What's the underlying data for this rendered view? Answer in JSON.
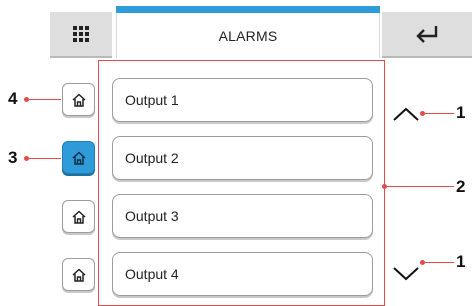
{
  "header": {
    "menu_icon": "grid-menu-icon",
    "title": "ALARMS",
    "back_icon": "enter-return-icon",
    "accent_color": "#2f9bd8"
  },
  "outputs": [
    {
      "label": "Output 1",
      "home_active": false
    },
    {
      "label": "Output 2",
      "home_active": true
    },
    {
      "label": "Output 3",
      "home_active": false
    },
    {
      "label": "Output 4",
      "home_active": false
    }
  ],
  "scroll": {
    "up_icon": "chevron-up-icon",
    "down_icon": "chevron-down-icon"
  },
  "callouts": {
    "scroll_up": "1",
    "scroll_down": "1",
    "list": "2",
    "home_active": "3",
    "home_button": "4",
    "color": "#e34a4a"
  }
}
